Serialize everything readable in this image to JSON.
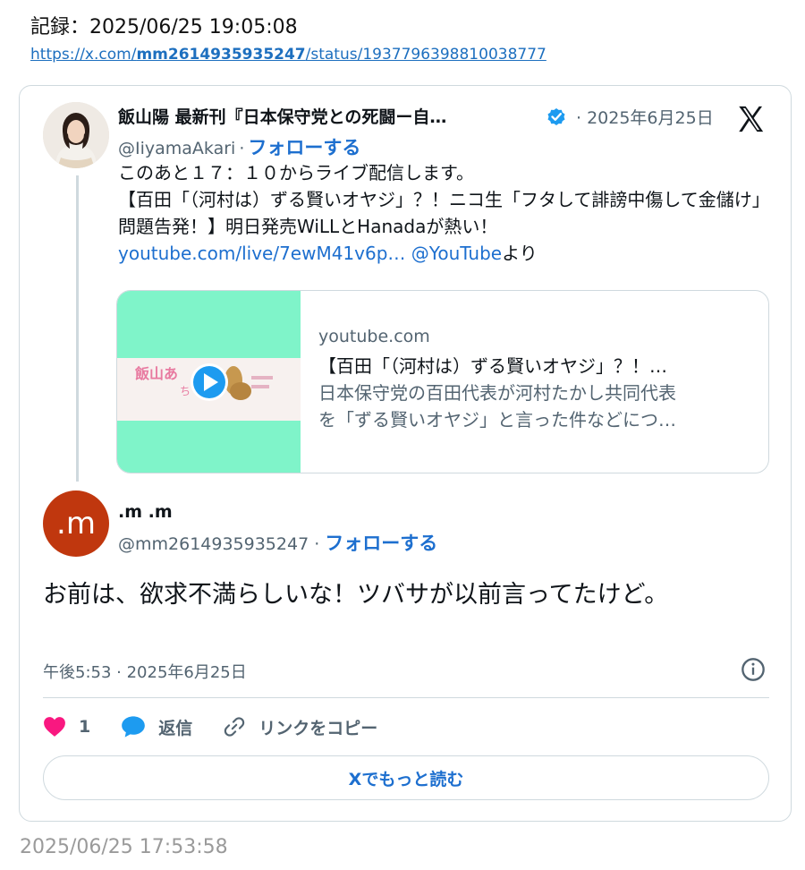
{
  "record": {
    "text": "記録：2025/06/25 19:05:08",
    "url_prefix": "https://x.com/",
    "url_user": "mm2614935935247",
    "url_suffix": "/status/1937796398810038777"
  },
  "quoted": {
    "name": "飯山陽 最新刊『日本保守党との死闘ー自…",
    "date": "· 2025年6月25日",
    "handle": "@IiyamaAkari",
    "follow_label": "フォローする",
    "text_line1": "このあと１７：１０からライブ配信します。",
    "text_line2": "【百田「（河村は）ずる賢いオヤジ」？！ニコ生「フタして誹謗中傷して金儲け」問題告発！】明日発売WiLLとHanadaが熱い！",
    "link": "youtube.com/live/7ewM41v6p…",
    "mention": "@YouTube",
    "yori": "より",
    "card": {
      "domain": "youtube.com",
      "title": "【百田「（河村は）ずる賢いオヤジ」？！…",
      "desc_line1": "日本保守党の百田代表が河村たかし共同代表",
      "desc_line2": "を「ずる賢いオヤジ」と言った件などにつ…",
      "thumb_text": "飯山あ",
      "thumb_sub": "ち"
    }
  },
  "reply": {
    "avatar_text": ".m",
    "name": ".m .m",
    "handle": "@mm2614935935247",
    "follow_label": "フォローする",
    "text": "お前は、欲求不満らしいな！ツバサが以前言ってたけど。",
    "timestamp": "午後5:53 · 2025年6月25日"
  },
  "actions": {
    "like_count": "1",
    "reply_label": "返信",
    "copy_label": "リンクをコピー"
  },
  "read_more": "Xでもっと読む",
  "bottom_time": "2025/06/25 17:53:58",
  "colors": {
    "accent": "#1d9bf0",
    "heart": "#f91880",
    "avatar_m": "#c0370e",
    "thumb_bg": "#7ff4c9"
  }
}
